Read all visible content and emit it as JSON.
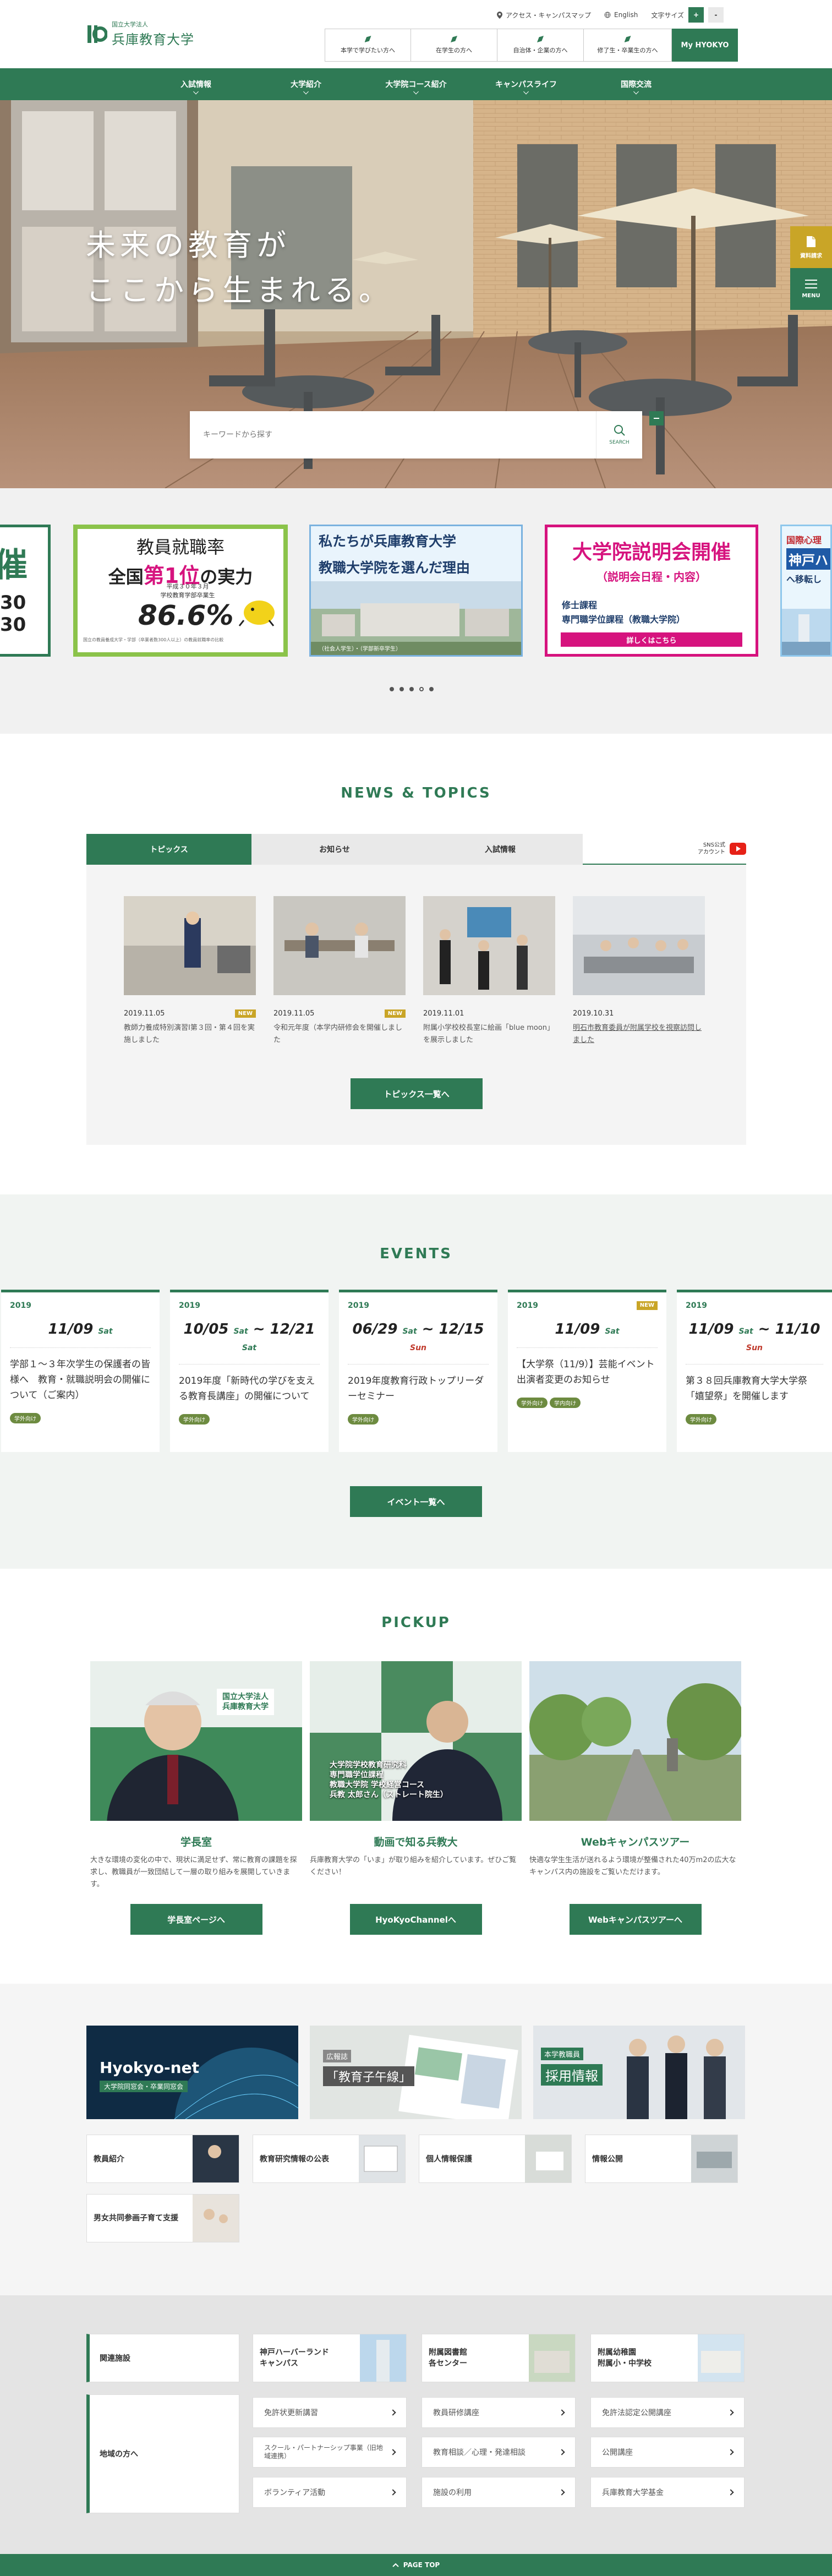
{
  "header": {
    "logo_sub": "国立大学法人",
    "logo_main": "兵庫教育大学",
    "top_links": [
      "アクセス・キャンパスマップ",
      "English"
    ],
    "font_size_label": "文字サイズ",
    "font_plus": "+",
    "font_minus": "-",
    "audiences": [
      "本学で学びたい方へ",
      "在学生の方へ",
      "自治体・企業の方へ",
      "修了生・卒業生の方へ"
    ],
    "my_label": "My HYOKYO"
  },
  "nav": [
    "入試情報",
    "大学紹介",
    "大学院コース紹介",
    "キャンパスライフ",
    "国際交流"
  ],
  "hero": {
    "line1": "未来の教育が",
    "line2": "ここから生まれる。",
    "search_placeholder": "キーワードから探す",
    "search_label": "SEARCH",
    "side_buttons": [
      "資料請求",
      "MENU"
    ]
  },
  "banners": {
    "b0_big": "催",
    "b0_nums": [
      "30",
      "30"
    ],
    "b1_title": "教員就職率",
    "b1_line": "全国",
    "b1_rank": "第1位",
    "b1_suffix": "の実力",
    "b1_sub1": "平成３０年３月",
    "b1_sub2": "学校教育学部卒業生",
    "b1_pct": "86.6%",
    "b1_note": "国立の教員養成大学・学部（卒業者数300人以上）の教員就職率の比較",
    "b2_title1": "私たちが兵庫教育大学",
    "b2_title2": "教職大学院を選んだ理由",
    "b2_caption": "（社会人学生）・（学部新卒学生）",
    "b3_title": "大学院説明会開催",
    "b3_sub": "（説明会日程・内容）",
    "b3_line1": "修士課程",
    "b3_line2": "専門職学位課程（教職大学院）",
    "b3_btn": "詳しくはこちら",
    "b4_title": "国際心理",
    "b4_city": "神戸ハ",
    "b4_sub": "へ移転し"
  },
  "news": {
    "title": "NEWS & TOPICS",
    "tabs": [
      "トピックス",
      "お知らせ",
      "入試情報"
    ],
    "sns": "SNS公式\nアカウント",
    "items": [
      {
        "date": "2019.11.05",
        "badge": "NEW",
        "text": "教師力養成特別演習Ⅰ第３回・第４回を実施しました"
      },
      {
        "date": "2019.11.05",
        "badge": "NEW",
        "text": "令和元年度（本学内研修会を開催しました"
      },
      {
        "date": "2019.11.01",
        "badge": "",
        "text": "附属小学校校長室に絵画「blue moon」を展示しました"
      },
      {
        "date": "2019.10.31",
        "badge": "",
        "text": "明石市教育委員が附属学校を視察訪問しました"
      }
    ],
    "more": "トピックス一覧へ"
  },
  "events": {
    "title": "EVENTS",
    "items": [
      {
        "year": "2019",
        "badge": "",
        "date": "11/09",
        "dow": "Sat",
        "date2": "",
        "dow2": "",
        "text": "学部１～３年次学生の保護者の皆様へ　教育・就職説明会の開催について（ご案内）",
        "tags": [
          "学外向け"
        ]
      },
      {
        "year": "2019",
        "badge": "",
        "date": "10/05",
        "dow": "Sat",
        "date2": "12/21",
        "dow2": "Sat",
        "text": "2019年度「新時代の学びを支える教育長講座」の開催について",
        "tags": [
          "学外向け"
        ]
      },
      {
        "year": "2019",
        "badge": "",
        "date": "06/29",
        "dow": "Sat",
        "date2": "12/15",
        "dow2": "Sun",
        "text": "2019年度教育行政トップリーダーセミナー",
        "tags": [
          "学外向け"
        ]
      },
      {
        "year": "2019",
        "badge": "NEW",
        "date": "11/09",
        "dow": "Sat",
        "date2": "",
        "dow2": "",
        "text": "【大学祭（11/9）】芸能イベント出演者変更のお知らせ",
        "tags": [
          "学外向け",
          "学内向け"
        ]
      },
      {
        "year": "2019",
        "badge": "",
        "date": "11/09",
        "dow": "Sat",
        "date2": "11/10",
        "dow2": "Sun",
        "text": "第３８回兵庫教育大学大学祭「嬉望祭」を開催します",
        "tags": [
          "学外向け"
        ]
      }
    ],
    "more": "イベント一覧へ"
  },
  "pickup": {
    "title": "PICKUP",
    "items": [
      {
        "heading": "学長室",
        "desc": "大きな環境の変化の中で、現状に満足せず、常に教育の課題を探求し、教職員が一致団結して一層の取り組みを展開していきます。",
        "btn": "学長室ページへ",
        "img_text": "国立大学法人\n兵庫教育大学"
      },
      {
        "heading": "動画で知る兵教大",
        "desc": "兵庫教育大学の「いま」が取り組みを紹介しています。ぜひご覧ください！",
        "btn": "HyoKyoChannelへ",
        "img_text": "大学院学校教育研究科\n専門職学位課程\n教職大学院 学校経営コース\n兵教 太郎さん（ストレート院生）"
      },
      {
        "heading": "Webキャンパスツアー",
        "desc": "快適な学生生活が送れるよう環境が整備された40万m2の広大なキャンパス内の施設をご覧いただけます。",
        "btn": "Webキャンパスツアーへ",
        "img_text": ""
      }
    ]
  },
  "promos": {
    "p1_title": "Hyokyo-net",
    "p1_sub": "大学院同窓会・卒業同窓会",
    "p2_small": "広報誌",
    "p2_title": "「教育子午線」",
    "p3_small": "本学教職員",
    "p3_title": "採用情報",
    "small_links": [
      "教員紹介",
      "教育研究情報の公表",
      "個人情報保護",
      "情報公開",
      "男女共同参画子育て支援"
    ]
  },
  "related": {
    "label1": "関連施設",
    "facilities": [
      "神戸ハーバーランド\nキャンパス",
      "附属図書館\n各センター",
      "附属幼稚園\n附属小・中学校"
    ],
    "label2": "地域の方へ",
    "links": [
      "免許状更新講習",
      "教員研修講座",
      "免許法認定公開講座",
      "スクール・パートナーシップ事業（旧地域連携）",
      "教育相談／心理・発達相談",
      "公開講座",
      "ボランティア活動",
      "施設の利用",
      "兵庫教育大学基金"
    ]
  },
  "footer": {
    "pagetop": "PAGE TOP"
  },
  "colors": {
    "brand": "#2f7a55",
    "gold": "#c9a527",
    "magenta": "#d6137e"
  }
}
